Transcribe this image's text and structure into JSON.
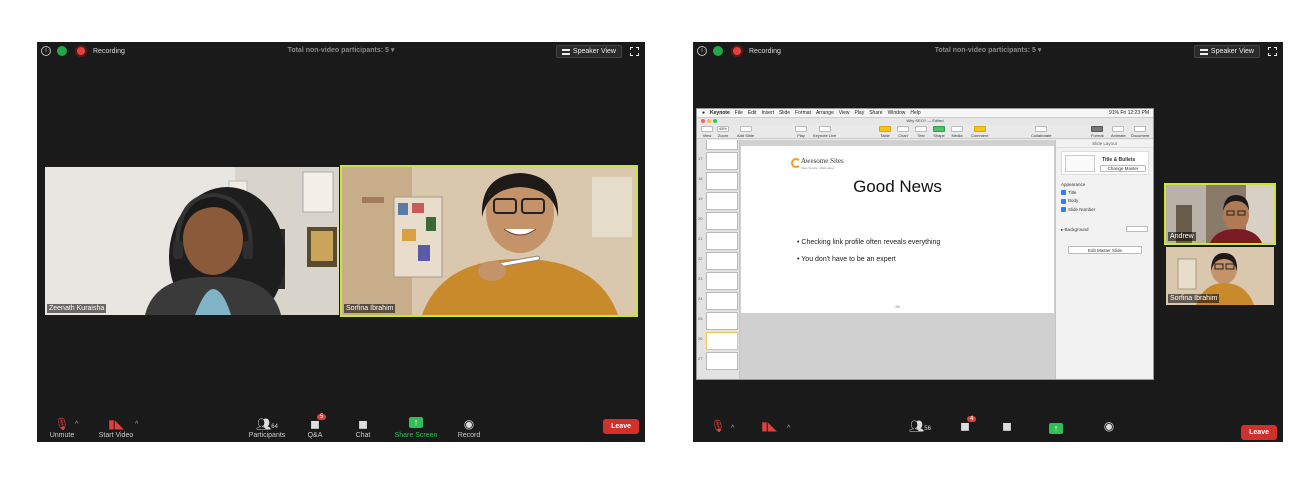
{
  "left": {
    "topbar": {
      "recording": "Recording",
      "title": "Total non-video participants: 5",
      "speaker_view": "Speaker View"
    },
    "participants": [
      {
        "name": "Zeenath Kuraisha"
      },
      {
        "name": "Sorfina Ibrahim"
      }
    ],
    "toolbar": {
      "unmute": "Unmute",
      "start_video": "Start Video",
      "participants_label": "Participants",
      "participants_count": "64",
      "qa_label": "Q&A",
      "qa_badge": "5",
      "chat_label": "Chat",
      "share_label": "Share Screen",
      "record_label": "Record",
      "leave": "Leave"
    }
  },
  "right": {
    "topbar": {
      "recording": "Recording",
      "title": "Total non-video participants: 5",
      "speaker_view": "Speaker View"
    },
    "keynote": {
      "menubar": [
        "Keynote",
        "File",
        "Edit",
        "Insert",
        "Slide",
        "Format",
        "Arrange",
        "View",
        "Play",
        "Share",
        "Window",
        "Help"
      ],
      "status": "91% Fri 12:23 PM",
      "window_title": "Why SEO? — Edited",
      "toolbar": [
        "View",
        "Zoom",
        "Add Slide",
        "Play",
        "Keynote Live",
        "Table",
        "Chart",
        "Text",
        "Shape",
        "Media",
        "Comment",
        "Collaborate",
        "Format",
        "Animate",
        "Document"
      ],
      "zoom": "48%",
      "slide": {
        "logo_text": "Awesome Sites",
        "logo_sub": "Sites Simple, Made Easy",
        "title": "Good News",
        "bullets": [
          "Checking link profile often reveals everything",
          "You don't have to be an expert"
        ],
        "number": "26"
      },
      "inspector": {
        "header": "Slide Layout",
        "layout_name": "Title & Bullets",
        "change_master": "Change Master",
        "appearance": "Appearance",
        "options": [
          "Title",
          "Body",
          "Slide Number"
        ],
        "background": "Background",
        "edit_master": "Edit Master Slide"
      },
      "thumb_numbers": [
        "17",
        "18",
        "19",
        "20",
        "21",
        "22",
        "23",
        "24",
        "25",
        "26",
        "27"
      ]
    },
    "participants": [
      {
        "name": "Andrew"
      },
      {
        "name": "Sorfina Ibrahim"
      }
    ],
    "toolbar": {
      "participants_count": "56",
      "qa_badge": "4",
      "leave": "Leave"
    }
  }
}
